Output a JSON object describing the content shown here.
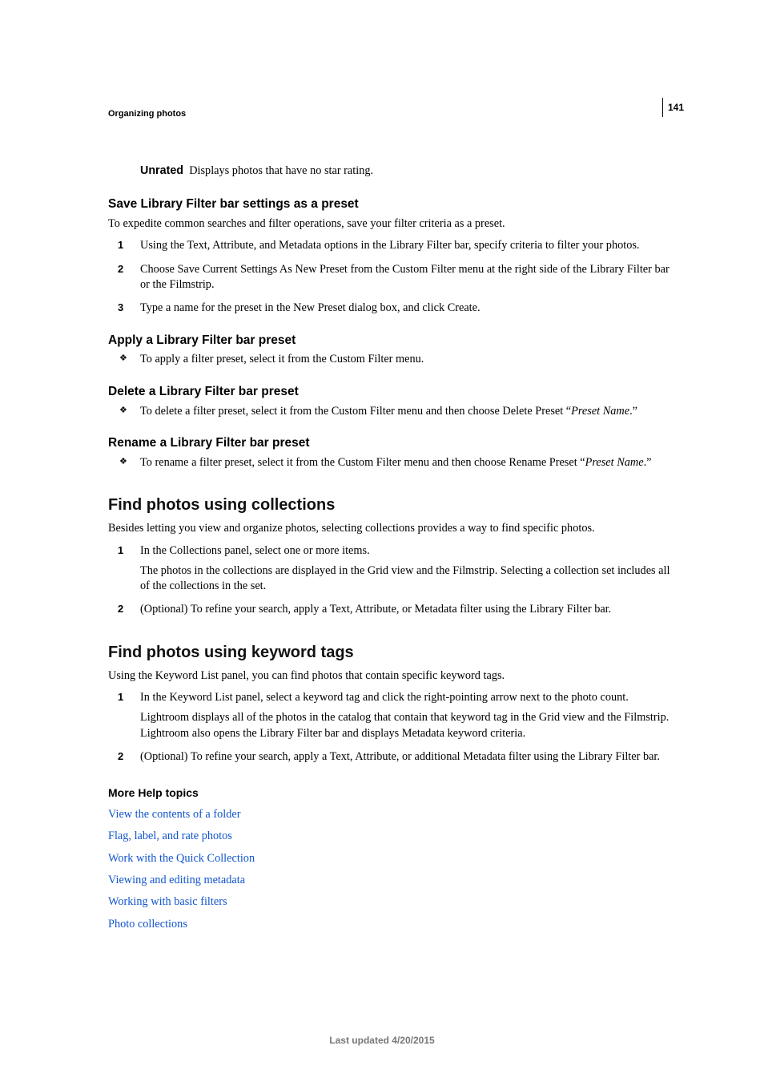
{
  "page_number": "141",
  "chapter": "Organizing photos",
  "unrated": {
    "term": "Unrated",
    "desc": "Displays photos that have no star rating."
  },
  "save_preset": {
    "title": "Save Library Filter bar settings as a preset",
    "intro": "To expedite common searches and filter operations, save your filter criteria as a preset.",
    "steps": [
      "Using the Text, Attribute, and Metadata options in the Library Filter bar, specify criteria to filter your photos.",
      "Choose Save Current Settings As New Preset from the Custom Filter menu at the right side of the Library Filter bar or the Filmstrip.",
      "Type a name for the preset in the New Preset dialog box, and click Create."
    ]
  },
  "apply_preset": {
    "title": "Apply a Library Filter bar preset",
    "bullet": "To apply a filter preset, select it from the Custom Filter menu."
  },
  "delete_preset": {
    "title": "Delete a Library Filter bar preset",
    "bullet_pre": "To delete a filter preset, select it from the Custom Filter menu and then choose Delete Preset “",
    "bullet_italic": "Preset Name",
    "bullet_post": ".”"
  },
  "rename_preset": {
    "title": "Rename a Library Filter bar preset",
    "bullet_pre": "To rename a filter preset, select it from the Custom Filter menu and then choose Rename Preset “",
    "bullet_italic": "Preset Name",
    "bullet_post": ".”"
  },
  "collections": {
    "title": "Find photos using collections",
    "intro": "Besides letting you view and organize photos, selecting collections provides a way to find specific photos.",
    "steps": [
      {
        "text": "In the Collections panel, select one or more items.",
        "sub": "The photos in the collections are displayed in the Grid view and the Filmstrip. Selecting a collection set includes all of the collections in the set."
      },
      {
        "text": "(Optional) To refine your search, apply a Text, Attribute, or Metadata filter using the Library Filter bar."
      }
    ]
  },
  "keywords": {
    "title": "Find photos using keyword tags",
    "intro": "Using the Keyword List panel, you can find photos that contain specific keyword tags.",
    "steps": [
      {
        "text": "In the Keyword List panel, select a keyword tag and click the right-pointing arrow next to the photo count.",
        "sub": "Lightroom displays all of the photos in the catalog that contain that keyword tag in the Grid view and the Filmstrip. Lightroom also opens the Library Filter bar and displays Metadata keyword criteria."
      },
      {
        "text": "(Optional) To refine your search, apply a Text, Attribute, or additional Metadata filter using the Library Filter bar."
      }
    ]
  },
  "more_help": {
    "title": "More Help topics",
    "links": [
      "View the contents of a folder",
      "Flag, label, and rate photos",
      "Work with the Quick Collection",
      "Viewing and editing metadata",
      "Working with basic filters",
      "Photo collections"
    ]
  },
  "footer": "Last updated 4/20/2015"
}
